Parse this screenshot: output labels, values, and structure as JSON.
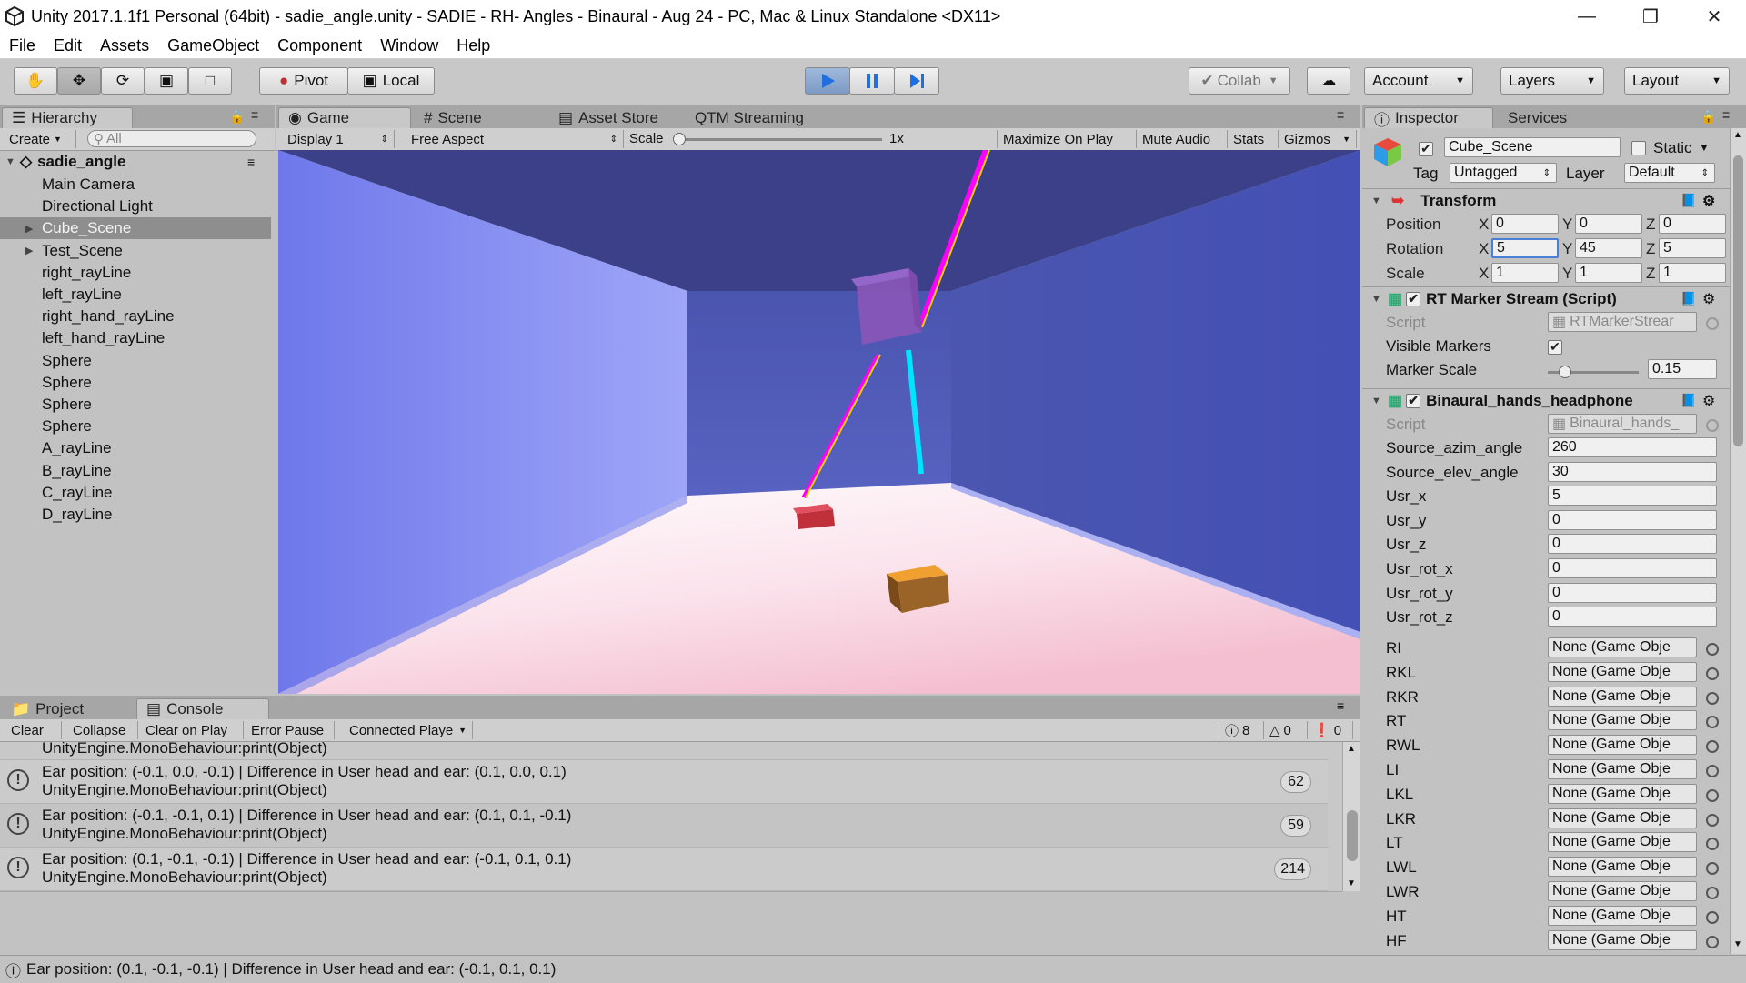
{
  "window": {
    "title": "Unity 2017.1.1f1 Personal (64bit) - sadie_angle.unity - SADIE - RH- Angles - Binaural - Aug 24 - PC, Mac & Linux Standalone <DX11>"
  },
  "menu": [
    "File",
    "Edit",
    "Assets",
    "GameObject",
    "Component",
    "Window",
    "Help"
  ],
  "toolbar": {
    "pivot": "Pivot",
    "local": "Local",
    "collab": "Collab",
    "account": "Account",
    "layers": "Layers",
    "layout": "Layout"
  },
  "hierarchy": {
    "tab": "Hierarchy",
    "create": "Create",
    "search_placeholder": "All",
    "scene": "sadie_angle",
    "items": [
      {
        "label": "Main Camera"
      },
      {
        "label": "Directional Light"
      },
      {
        "label": "Cube_Scene"
      },
      {
        "label": "Test_Scene"
      },
      {
        "label": "right_rayLine"
      },
      {
        "label": "left_rayLine"
      },
      {
        "label": "right_hand_rayLine"
      },
      {
        "label": "left_hand_rayLine"
      },
      {
        "label": "Sphere"
      },
      {
        "label": "Sphere"
      },
      {
        "label": "Sphere"
      },
      {
        "label": "Sphere"
      },
      {
        "label": "A_rayLine"
      },
      {
        "label": "B_rayLine"
      },
      {
        "label": "C_rayLine"
      },
      {
        "label": "D_rayLine"
      }
    ]
  },
  "game": {
    "tabs": {
      "game": "Game",
      "scene": "Scene",
      "asset_store": "Asset Store",
      "qtm": "QTM Streaming"
    },
    "display": "Display 1",
    "aspect": "Free Aspect",
    "scale_label": "Scale",
    "scale_value": "1x",
    "maximize": "Maximize On Play",
    "mute": "Mute Audio",
    "stats": "Stats",
    "gizmos": "Gizmos"
  },
  "inspector": {
    "tab": "Inspector",
    "services_tab": "Services",
    "object_name": "Cube_Scene",
    "static_label": "Static",
    "tag_label": "Tag",
    "tag_value": "Untagged",
    "layer_label": "Layer",
    "layer_value": "Default",
    "transform": {
      "title": "Transform",
      "position_label": "Position",
      "rotation_label": "Rotation",
      "scale_label": "Scale",
      "position": [
        "0",
        "0",
        "0"
      ],
      "rotation": [
        "5",
        "45",
        "5"
      ],
      "scale": [
        "1",
        "1",
        "1"
      ]
    },
    "rt_marker": {
      "title": "RT Marker Stream (Script)",
      "script_label": "Script",
      "script_value": "RTMarkerStrear",
      "visible_label": "Visible Markers",
      "marker_scale_label": "Marker Scale",
      "marker_scale_value": "0.15"
    },
    "binaural": {
      "title": "Binaural_hands_headphone",
      "script_label": "Script",
      "script_value": "Binaural_hands_",
      "fields": [
        {
          "label": "Source_azim_angle",
          "value": "260"
        },
        {
          "label": "Source_elev_angle",
          "value": "30"
        },
        {
          "label": "Usr_x",
          "value": "5"
        },
        {
          "label": "Usr_y",
          "value": "0"
        },
        {
          "label": "Usr_z",
          "value": "0"
        },
        {
          "label": "Usr_rot_x",
          "value": "0"
        },
        {
          "label": "Usr_rot_y",
          "value": "0"
        },
        {
          "label": "Usr_rot_z",
          "value": "0"
        }
      ],
      "objects": [
        {
          "label": "RI",
          "value": "None (Game Obje"
        },
        {
          "label": "RKL",
          "value": "None (Game Obje"
        },
        {
          "label": "RKR",
          "value": "None (Game Obje"
        },
        {
          "label": "RT",
          "value": "None (Game Obje"
        },
        {
          "label": "RWL",
          "value": "None (Game Obje"
        },
        {
          "label": "LI",
          "value": "None (Game Obje"
        },
        {
          "label": "LKL",
          "value": "None (Game Obje"
        },
        {
          "label": "LKR",
          "value": "None (Game Obje"
        },
        {
          "label": "LT",
          "value": "None (Game Obje"
        },
        {
          "label": "LWL",
          "value": "None (Game Obje"
        },
        {
          "label": "LWR",
          "value": "None (Game Obje"
        },
        {
          "label": "HT",
          "value": "None (Game Obje"
        },
        {
          "label": "HF",
          "value": "None (Game Obje"
        }
      ]
    }
  },
  "console": {
    "project_tab": "Project",
    "console_tab": "Console",
    "buttons": {
      "clear": "Clear",
      "collapse": "Collapse",
      "clear_on_play": "Clear on Play",
      "error_pause": "Error Pause",
      "connected": "Connected Playe"
    },
    "counts": {
      "warnings": "8",
      "alerts": "0",
      "errors": "0"
    },
    "partial_line": "UnityEngine.MonoBehaviour:print(Object)",
    "entries": [
      {
        "line1": "Ear position: (-0.1, 0.0, -0.1) | Difference in User head and ear: (0.1, 0.0, 0.1)",
        "line2": "UnityEngine.MonoBehaviour:print(Object)",
        "count": "62"
      },
      {
        "line1": "Ear position: (-0.1, -0.1, 0.1) | Difference in User head and ear: (0.1, 0.1, -0.1)",
        "line2": "UnityEngine.MonoBehaviour:print(Object)",
        "count": "59"
      },
      {
        "line1": "Ear position: (0.1, -0.1, -0.1) | Difference in User head and ear: (-0.1, 0.1, 0.1)",
        "line2": "UnityEngine.MonoBehaviour:print(Object)",
        "count": "214"
      }
    ]
  },
  "status_bar": {
    "text": "Ear position: (0.1, -0.1, -0.1) | Difference in User head and ear: (-0.1, 0.1, 0.1)"
  }
}
